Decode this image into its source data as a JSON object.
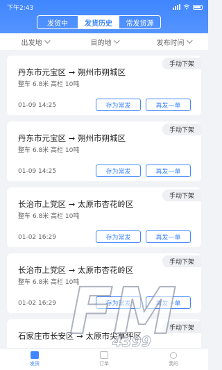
{
  "status": {
    "time": "下午2:43"
  },
  "segment": {
    "tabs": [
      {
        "label": "发货中"
      },
      {
        "label": "发货历史"
      },
      {
        "label": "常发货源"
      }
    ]
  },
  "filters": {
    "origin": "出发地",
    "destination": "目的地",
    "time": "发布时间"
  },
  "orders": [
    {
      "tag": "手动下架",
      "route": "丹东市元宝区 → 朔州市朔城区",
      "spec": "整车 6.8米 高栏 10吨",
      "date": "01-09 14:25",
      "save_label": "存为常发",
      "reorder_label": "再发一单"
    },
    {
      "tag": "手动下架",
      "route": "丹东市元宝区 → 朔州市朔城区",
      "spec": "整车 6.8米 高栏 10吨",
      "date": "01-09 14:25",
      "save_label": "存为常发",
      "reorder_label": "再发一单"
    },
    {
      "tag": "手动下架",
      "route": "长治市上党区 → 太原市杏花岭区",
      "spec": "整车 6.8米 高栏 10吨",
      "date": "01-02 16:29",
      "save_label": "存为常发",
      "reorder_label": "再发一单"
    },
    {
      "tag": "手动下架",
      "route": "长治市上党区 → 太原市杏花岭区",
      "spec": "整车 6.8米 高栏 10吨",
      "date": "01-02 16:29",
      "save_label": "存为常发",
      "reorder_label": "再发一单"
    },
    {
      "tag": "手动下架",
      "route": "石家庄市长安区 → 太原市尖草坪区",
      "spec": "",
      "date": "",
      "save_label": "",
      "reorder_label": ""
    }
  ],
  "tabbar": {
    "items": [
      {
        "label": "发货"
      },
      {
        "label": "订单"
      },
      {
        "label": "我的"
      }
    ]
  },
  "watermark": {
    "text": "FM",
    "sub": "4399"
  },
  "colors": {
    "accent": "#3f86ff",
    "background": "#f2f3f7"
  }
}
